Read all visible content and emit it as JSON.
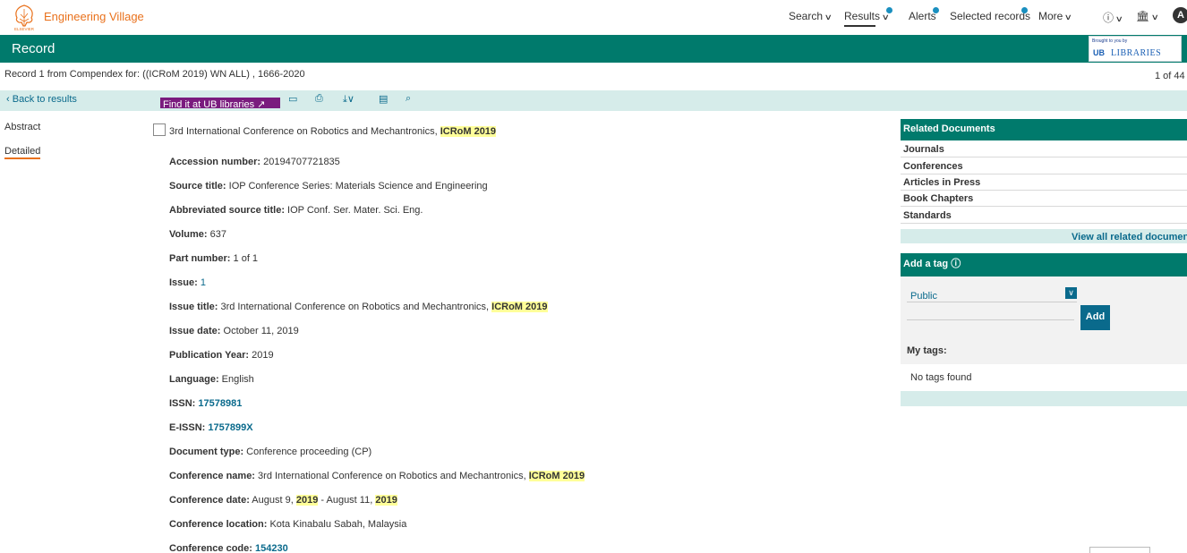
{
  "app": {
    "brand": "Engineering Village",
    "logo_text": "ELSEVIER"
  },
  "nav": {
    "search": "Search",
    "results": "Results",
    "alerts": "Alerts",
    "selected_records": "Selected records",
    "more": "More",
    "avatar": "A"
  },
  "record_bar": {
    "title": "Record",
    "ub_small": "Brought to you by",
    "ub_mark": "UB",
    "ub_lib": "LIBRARIES"
  },
  "record_info": "Record 1 from Compendex for: ((ICRoM 2019) WN ALL) , 1666-2020",
  "page_of": "1 of 44",
  "toolbar": {
    "back": "Back to results",
    "find_it": "Find it at UB libraries"
  },
  "left_nav": {
    "abstract": "Abstract",
    "detailed": "Detailed"
  },
  "doc": {
    "title_pre": "3rd International Conference on Robotics and Mechantronics, ",
    "title_hl": "ICRoM 2019",
    "fields": {
      "accession": {
        "label": "Accession number:",
        "value": " 20194707721835"
      },
      "source": {
        "label": "Source title:",
        "value": " IOP Conference Series: Materials Science and Engineering"
      },
      "abbrev": {
        "label": "Abbreviated source title:",
        "value": " IOP Conf. Ser. Mater. Sci. Eng."
      },
      "volume": {
        "label": "Volume:",
        "value": " 637"
      },
      "part": {
        "label": "Part number:",
        "value": " 1 of 1"
      },
      "issue": {
        "label": "Issue:",
        "value": "1"
      },
      "issue_title": {
        "label": "Issue title:",
        "value": " 3rd International Conference on Robotics and Mechantronics, ",
        "hl": "ICRoM 2019"
      },
      "issue_date": {
        "label": "Issue date:",
        "value": " October 11, 2019"
      },
      "pub_year": {
        "label": "Publication Year:",
        "value": " 2019"
      },
      "language": {
        "label": "Language:",
        "value": " English"
      },
      "issn": {
        "label": "ISSN:",
        "value": "17578981"
      },
      "eissn": {
        "label": "E-ISSN:",
        "value": "1757899X"
      },
      "doctype": {
        "label": "Document type:",
        "value": " Conference proceeding (CP)"
      },
      "conf_name": {
        "label": "Conference name:",
        "value": " 3rd International Conference on Robotics and Mechantronics, ",
        "hl": "ICRoM 2019"
      },
      "conf_date": {
        "label": "Conference date:",
        "v1": " August 9, ",
        "h1": "2019",
        "v2": " - August 11, ",
        "h2": "2019"
      },
      "conf_loc": {
        "label": "Conference location:",
        "value": " Kota Kinabalu Sabah, Malaysia"
      },
      "conf_code": {
        "label": "Conference code:",
        "value": "154230"
      }
    }
  },
  "related": {
    "title": "Related Documents",
    "items": [
      "Journals",
      "Conferences",
      "Articles in Press",
      "Book Chapters",
      "Standards"
    ],
    "view_all": "View all related documents"
  },
  "tags": {
    "title": "Add a tag",
    "public": "Public",
    "add": "Add",
    "my_tags": "My tags:",
    "no_tags": "No tags found"
  },
  "colors": {
    "teal": "#007a6c",
    "light_teal": "#d6ecea",
    "orange": "#e9711c",
    "link": "#0a6a8c",
    "purple": "#7a1b7e",
    "highlight": "#ffff99"
  }
}
